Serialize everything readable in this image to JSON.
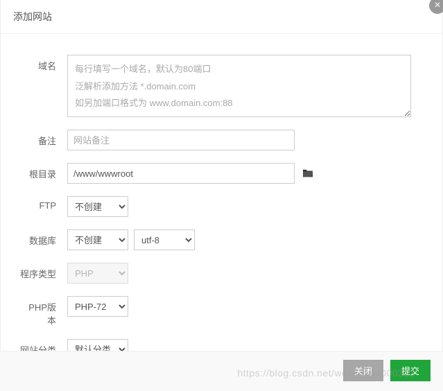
{
  "header": {
    "title": "添加网站"
  },
  "form": {
    "domain": {
      "label": "域名",
      "placeholder": "每行填写一个域名，默认为80端口\n泛解析添加方法 *.domain.com\n如另加端口格式为 www.domain.com:88",
      "value": ""
    },
    "note": {
      "label": "备注",
      "placeholder": "网站备注",
      "value": ""
    },
    "root": {
      "label": "根目录",
      "value": "/www/wwwroot"
    },
    "ftp": {
      "label": "FTP",
      "selected": "不创建"
    },
    "database": {
      "label": "数据库",
      "selected": "不创建",
      "charset": "utf-8"
    },
    "program_type": {
      "label": "程序类型",
      "selected": "PHP"
    },
    "php_version": {
      "label": "PHP版本",
      "selected": "PHP-72"
    },
    "category": {
      "label": "网站分类",
      "selected": "默认分类"
    }
  },
  "footer": {
    "close": "关闭",
    "submit": "提交"
  },
  "watermark": "https://blog.csdn.net/weixin_44000323"
}
